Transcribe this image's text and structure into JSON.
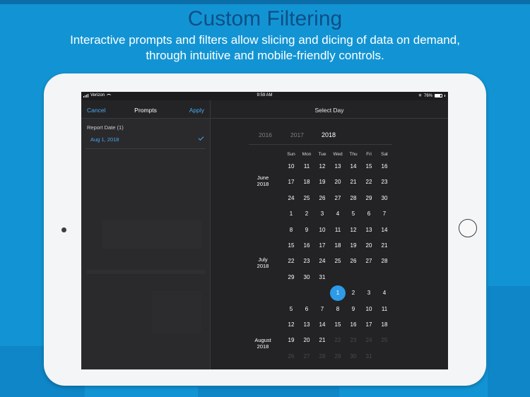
{
  "promo": {
    "title": "Custom Filtering",
    "subtitle_line1": "Interactive prompts and filters allow slicing and dicing of data on demand,",
    "subtitle_line2": "through intuitive and mobile-friendly controls."
  },
  "status_bar": {
    "carrier": "Verizon",
    "time": "9:59 AM",
    "battery": "76%",
    "battery_level": 0.76
  },
  "prompts_panel": {
    "cancel_label": "Cancel",
    "title": "Prompts",
    "apply_label": "Apply",
    "section_label": "Report Date (1)",
    "selected_value": "Aug 1, 2018"
  },
  "calendar": {
    "title": "Select Day",
    "years": [
      "2016",
      "2017",
      "2018"
    ],
    "selected_year": "2018",
    "weekdays": [
      "Sun",
      "Mon",
      "Tue",
      "Wed",
      "Thu",
      "Fri",
      "Sat"
    ],
    "months": [
      {
        "name": "June",
        "year": "2018"
      },
      {
        "name": "July",
        "year": "2018"
      },
      {
        "name": "August",
        "year": "2018"
      }
    ],
    "rows": [
      [
        "10",
        "11",
        "12",
        "13",
        "14",
        "15",
        "16"
      ],
      [
        "17",
        "18",
        "19",
        "20",
        "21",
        "22",
        "23"
      ],
      [
        "24",
        "25",
        "26",
        "27",
        "28",
        "29",
        "30"
      ],
      [
        "1",
        "2",
        "3",
        "4",
        "5",
        "6",
        "7"
      ],
      [
        "8",
        "9",
        "10",
        "11",
        "12",
        "13",
        "14"
      ],
      [
        "15",
        "16",
        "17",
        "18",
        "19",
        "20",
        "21"
      ],
      [
        "22",
        "23",
        "24",
        "25",
        "26",
        "27",
        "28"
      ],
      [
        "29",
        "30",
        "31",
        "",
        "",
        "",
        ""
      ],
      [
        "",
        "",
        "",
        "1",
        "2",
        "3",
        "4"
      ],
      [
        "5",
        "6",
        "7",
        "8",
        "9",
        "10",
        "11"
      ],
      [
        "12",
        "13",
        "14",
        "15",
        "16",
        "17",
        "18"
      ],
      [
        "19",
        "20",
        "21",
        "22",
        "23",
        "24",
        "25"
      ],
      [
        "26",
        "27",
        "28",
        "29",
        "30",
        "31",
        ""
      ]
    ],
    "selected_day": "1"
  },
  "colors": {
    "accent": "#2d9be8",
    "link": "#4aa8ec",
    "background": "#1294d4"
  }
}
